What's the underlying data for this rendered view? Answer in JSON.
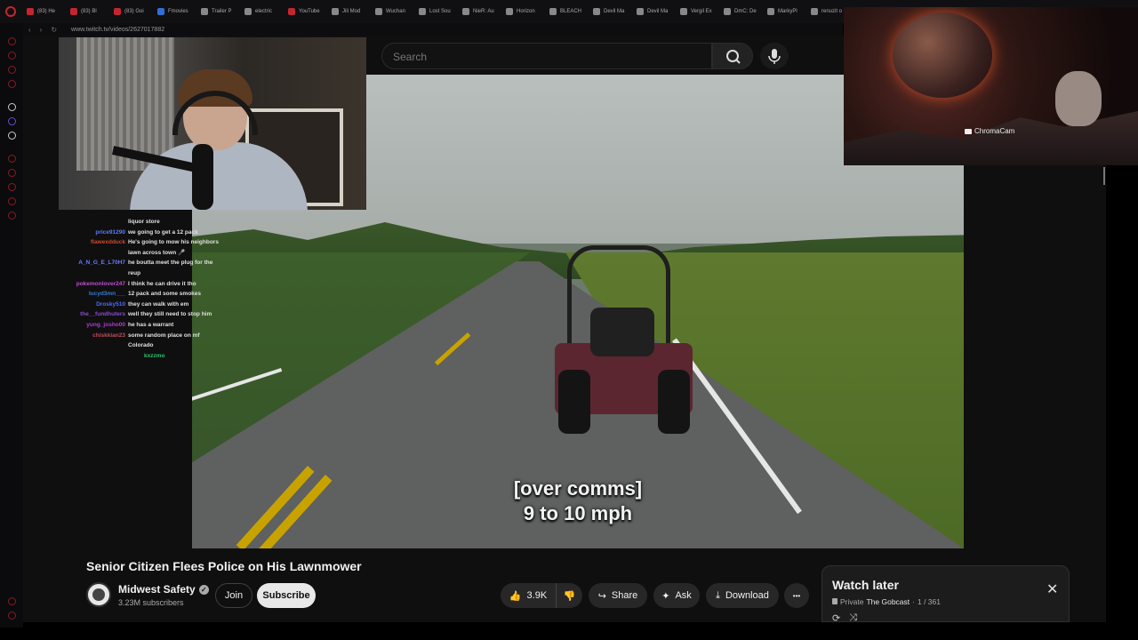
{
  "browser": {
    "tabs": [
      {
        "label": "(83) He",
        "color": "#c3262e"
      },
      {
        "label": "(83) Bl",
        "color": "#c3262e"
      },
      {
        "label": "(83) Goi",
        "color": "#c3262e"
      },
      {
        "label": "Fmovies",
        "color": "#2f6fd6"
      },
      {
        "label": "Trailer P",
        "color": "#888888"
      },
      {
        "label": "electric",
        "color": "#888888"
      },
      {
        "label": "YouTube",
        "color": "#c3262e"
      },
      {
        "label": "Jili Mod",
        "color": "#888888"
      },
      {
        "label": "Wuchan",
        "color": "#888888"
      },
      {
        "label": "Lost Sou",
        "color": "#888888"
      },
      {
        "label": "NieR: Au",
        "color": "#888888"
      },
      {
        "label": "Horizon",
        "color": "#888888"
      },
      {
        "label": "BLEACH",
        "color": "#888888"
      },
      {
        "label": "Devil Ma",
        "color": "#888888"
      },
      {
        "label": "Devil Ma",
        "color": "#888888"
      },
      {
        "label": "Vergil Ex",
        "color": "#888888"
      },
      {
        "label": "DmC: De",
        "color": "#888888"
      },
      {
        "label": "MarkyPl",
        "color": "#888888"
      },
      {
        "label": "renuzit o",
        "color": "#888888"
      }
    ],
    "url": "www.twitch.tv/videos/2627017882",
    "back_icon": "‹",
    "forward_icon": "›",
    "reload_icon": "↻"
  },
  "search": {
    "placeholder": "Search"
  },
  "video": {
    "caption_line1": "[over comms]",
    "caption_line2": "9 to 10 mph"
  },
  "chat": {
    "messages": [
      {
        "user": "",
        "text": "liquor store",
        "color": "#9b9bff"
      },
      {
        "user": "price91290",
        "text": "we going to get a 12 pack",
        "color": "#5b7bff"
      },
      {
        "user": "flawexdduck",
        "text": "He's going to mow his neighbors",
        "color": "#d04a2a"
      },
      {
        "user": "",
        "text": "lawn across town 🎤",
        "color": "#9b9bff"
      },
      {
        "user": "A_N_G_E_L70H7",
        "text": "he boutta meet the plug for the",
        "color": "#6a7bff"
      },
      {
        "user": "",
        "text": "reup",
        "color": "#9b9bff"
      },
      {
        "user": "pokemonlover247",
        "text": "I think he can drive it tho",
        "color": "#c14ad6"
      },
      {
        "user": "lucyd3mn___",
        "text": "12 pack and some smokes",
        "color": "#3a7bd6"
      },
      {
        "user": "Drosky510",
        "text": "they can walk with em",
        "color": "#4a6bff"
      },
      {
        "user": "the__fundhuters",
        "text": "well they still need to stop him",
        "color": "#8a4ad6"
      },
      {
        "user": "yung_josho00",
        "text": "he has a warrant",
        "color": "#b03ad6"
      },
      {
        "user": "chiskkian23",
        "text": "some random place on mf",
        "color": "#c14a5a"
      },
      {
        "user": "",
        "text": "Colorado",
        "color": "#9b9bff"
      },
      {
        "user": "",
        "text": "kxzzmo",
        "color": "#2ac46a"
      }
    ]
  },
  "overlay": {
    "label": "ChromaCam"
  },
  "watch": {
    "title": "Senior Citizen Flees Police on His Lawnmower",
    "channel": "Midwest Safety",
    "verified_icon": "✓",
    "subscribers": "3.23M subscribers",
    "join": "Join",
    "subscribe": "Subscribe",
    "likes": "3.9K",
    "like_icon": "👍",
    "dislike_icon": "👎",
    "share": "Share",
    "share_icon": "↪",
    "ask": "Ask",
    "ask_icon": "✦",
    "download": "Download",
    "download_icon": "⤓",
    "more_icon": "•••"
  },
  "watch_later": {
    "title": "Watch later",
    "privacy": "Private",
    "channel": "The Gobcast",
    "position": "1 / 361",
    "close_icon": "✕",
    "loop_icon": "⟳",
    "shuffle_icon": "⤨"
  }
}
